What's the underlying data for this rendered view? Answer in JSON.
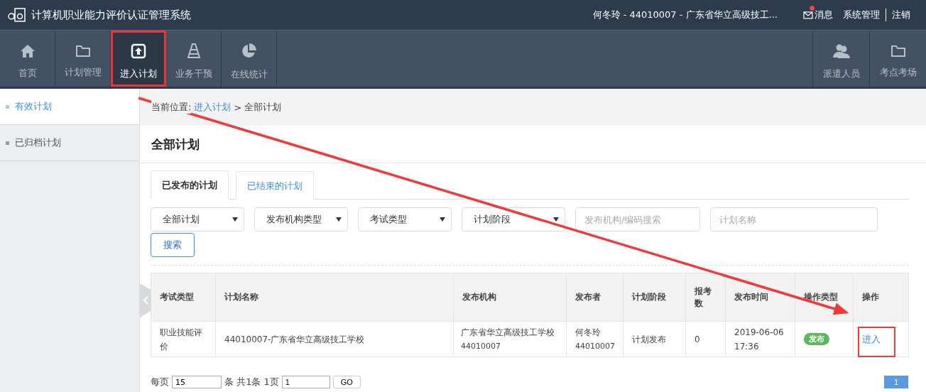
{
  "header": {
    "title": "计算机职业能力评价认证管理系统",
    "user": "何冬玲 - 44010007 - 广东省华立高级技工...",
    "links": [
      {
        "kind": "message",
        "label": "消息",
        "unread": true
      },
      {
        "kind": "plain",
        "label": "系统管理"
      },
      {
        "kind": "divided",
        "label": "注销"
      }
    ]
  },
  "nav": {
    "left": [
      {
        "kind": "home",
        "label": "首页",
        "selected": false
      },
      {
        "kind": "folder",
        "label": "计划管理",
        "selected": false
      },
      {
        "kind": "enter",
        "label": "进入计划",
        "selected": true
      },
      {
        "kind": "cone",
        "label": "业务干预",
        "selected": false
      },
      {
        "kind": "pie",
        "label": "在线统计",
        "selected": false
      }
    ],
    "right": [
      {
        "kind": "users",
        "label": "派遣人员",
        "selected": false
      },
      {
        "kind": "folder",
        "label": "考点考场",
        "selected": false
      }
    ]
  },
  "sidebar": {
    "items": [
      {
        "label": "有效计划",
        "selected": true
      },
      {
        "label": "已归档计划",
        "selected": false
      }
    ]
  },
  "breadcrumb": {
    "prefix": "当前位置:",
    "link": "进入计划",
    "separator": ">",
    "current": "全部计划"
  },
  "page_title": "全部计划",
  "tabs": [
    {
      "label": "已发布的计划",
      "selected": true
    },
    {
      "label": "已结束的计划",
      "selected": false
    }
  ],
  "filters": {
    "selects": [
      "全部计划",
      "发布机构类型",
      "考试类型",
      "计划阶段"
    ],
    "inputs": [
      {
        "placeholder": "发布机构/编码搜索"
      },
      {
        "placeholder": "计划名称"
      }
    ],
    "button": "搜索"
  },
  "table": {
    "columns": [
      "考试类型",
      "计划名称",
      "发布机构",
      "发布者",
      "计划阶段",
      "报考数",
      "发布时间",
      "操作类型",
      "操作"
    ],
    "rows": [
      {
        "exam_type": "职业技能评价",
        "plan_name": "44010007-广东省华立高级技工学校",
        "org": "广东省华立高级技工学校",
        "org_code": "44010007",
        "publisher": "何冬玲",
        "publisher_code": "44010007",
        "stage": "计划发布",
        "count": "0",
        "time": "2019-06-06 17:36",
        "op_type": "发布",
        "action": "进入"
      }
    ]
  },
  "pagination": {
    "per_page_prefix": "每页",
    "per_page": "15",
    "summary": "条 共1条 1页",
    "page_input": "1",
    "go": "GO",
    "pages": [
      {
        "label": "1",
        "selected": true
      }
    ]
  }
}
